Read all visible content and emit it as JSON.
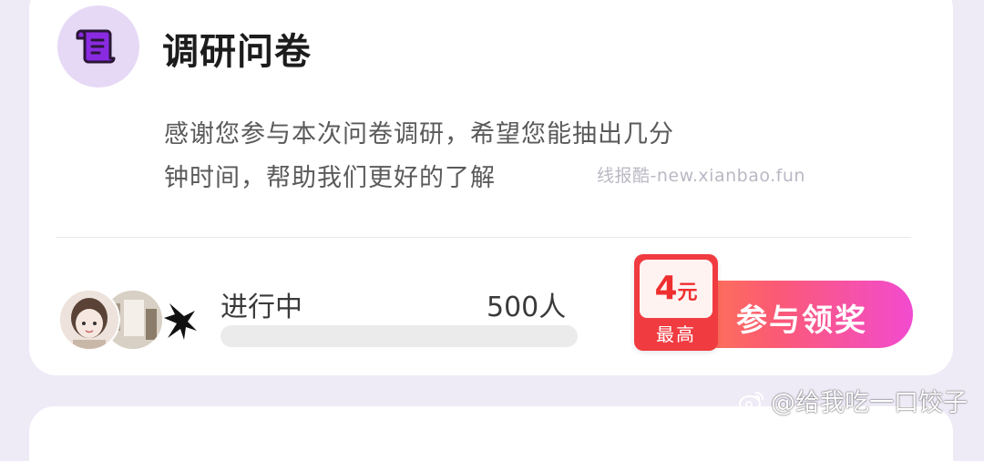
{
  "survey": {
    "icon": "scroll-icon",
    "title": "调研问卷",
    "description": "感谢您参与本次问卷调研，希望您能抽出几分钟时间，帮助我们更好的了解",
    "status": "进行中",
    "participants": "500人",
    "progress": 0,
    "reward": {
      "amount": "4",
      "unit": "元",
      "caption": "最高"
    },
    "cta_label": "参与领奖",
    "accent_colors": {
      "icon_bg": "#e6d9f6",
      "cta_start": "#ff8a3d",
      "cta_end": "#f24bd0",
      "badge": "#f03b41"
    }
  },
  "watermarks": {
    "site": "线报酷-new.xianbao.fun",
    "weibo": "@给我吃一口饺子"
  }
}
